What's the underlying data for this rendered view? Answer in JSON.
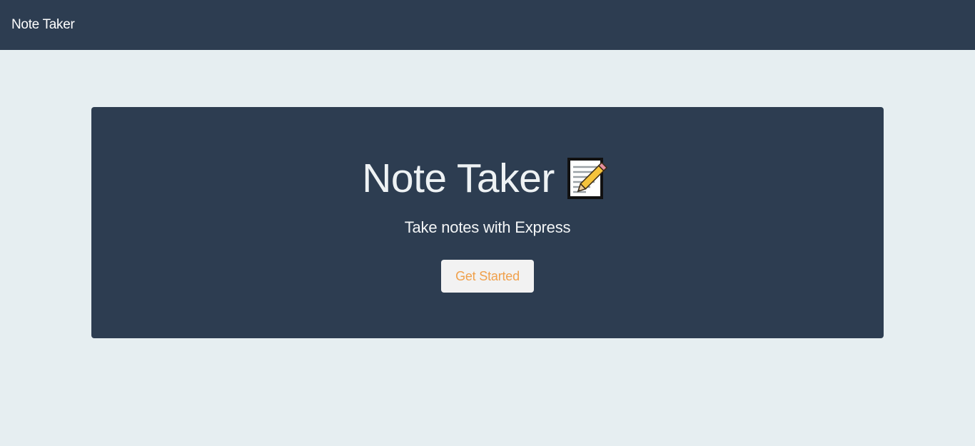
{
  "navbar": {
    "brand": "Note Taker",
    "background": "#2d3d51"
  },
  "hero": {
    "title": "Note Taker",
    "icon": "memo-icon",
    "subtitle": "Take notes with Express",
    "button_label": "Get Started",
    "button_text_color": "#f0a04b",
    "background": "#2d3d51"
  },
  "page": {
    "background": "#e6eef1"
  }
}
